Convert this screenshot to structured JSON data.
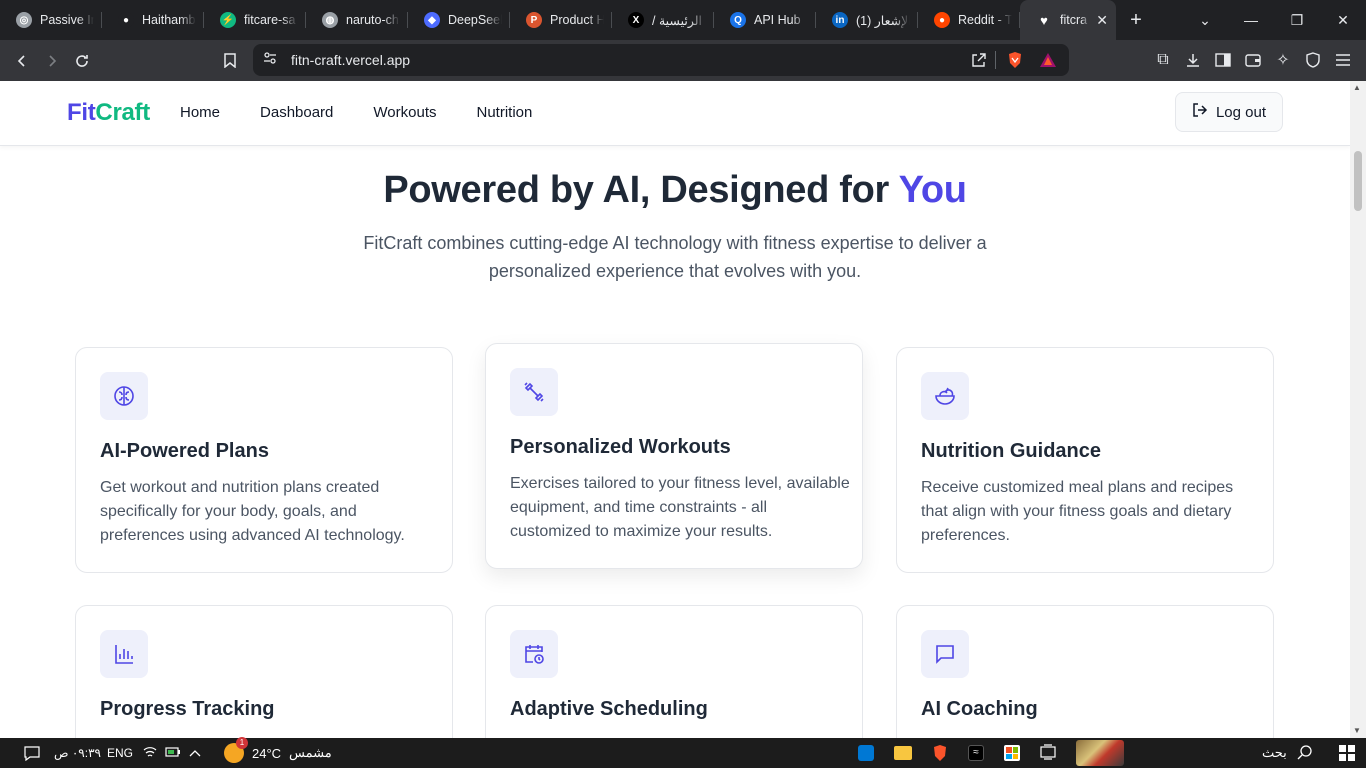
{
  "browser": {
    "tabs": [
      {
        "title": "Passive In",
        "fav_color": "#9aa0a6",
        "fav_char": "◎"
      },
      {
        "title": "Haithamb",
        "fav_color": "#202124",
        "fav_char": "●"
      },
      {
        "title": "fitcare-sa",
        "fav_color": "#10b981",
        "fav_char": "⚡"
      },
      {
        "title": "naruto-ch",
        "fav_color": "#9aa0a6",
        "fav_char": "◍"
      },
      {
        "title": "DeepSeek",
        "fav_color": "#4d6bfe",
        "fav_char": "◆"
      },
      {
        "title": "Product H",
        "fav_color": "#da552f",
        "fav_char": "P"
      },
      {
        "title": "/ الرئيسية",
        "fav_color": "#000000",
        "fav_char": "X"
      },
      {
        "title": "API Hub",
        "fav_color": "#1a73e8",
        "fav_char": "Q"
      },
      {
        "title": "(1) الإشعار",
        "fav_color": "#0a66c2",
        "fav_char": "in"
      },
      {
        "title": "Reddit - T",
        "fav_color": "#ff4500",
        "fav_char": "●"
      },
      {
        "title": "fitcra",
        "fav_color": "#ffffff",
        "fav_char": "♥"
      }
    ],
    "url": "fitn-craft.vercel.app"
  },
  "header": {
    "logo_part1": "Fit",
    "logo_part2": "Craft",
    "nav": [
      "Home",
      "Dashboard",
      "Workouts",
      "Nutrition"
    ],
    "logout_label": "Log out"
  },
  "hero": {
    "title_main": "Powered by AI, Designed for ",
    "title_highlight": "You",
    "subtitle": "FitCraft combines cutting-edge AI technology with fitness expertise to deliver a personalized experience that evolves with you."
  },
  "features": [
    {
      "title": "AI-Powered Plans",
      "desc": "Get workout and nutrition plans created specifically for your body, goals, and preferences using advanced AI technology.",
      "icon": "brain-icon"
    },
    {
      "title": "Personalized Workouts",
      "desc": "Exercises tailored to your fitness level, available equipment, and time constraints - all customized to maximize your results.",
      "icon": "dumbbell-icon"
    },
    {
      "title": "Nutrition Guidance",
      "desc": "Receive customized meal plans and recipes that align with your fitness goals and dietary preferences.",
      "icon": "salad-icon"
    },
    {
      "title": "Progress Tracking",
      "desc": "",
      "icon": "bar-chart-icon"
    },
    {
      "title": "Adaptive Scheduling",
      "desc": "",
      "icon": "calendar-clock-icon"
    },
    {
      "title": "AI Coaching",
      "desc": "",
      "icon": "message-icon"
    }
  ],
  "taskbar": {
    "time": "٠٩:٣٩ ص",
    "lang": "ENG",
    "temp": "24°C",
    "weather": "مشمس",
    "search": "بحث",
    "badge": "1"
  },
  "colors": {
    "accent": "#4f46e5",
    "brand_green": "#10b981"
  }
}
